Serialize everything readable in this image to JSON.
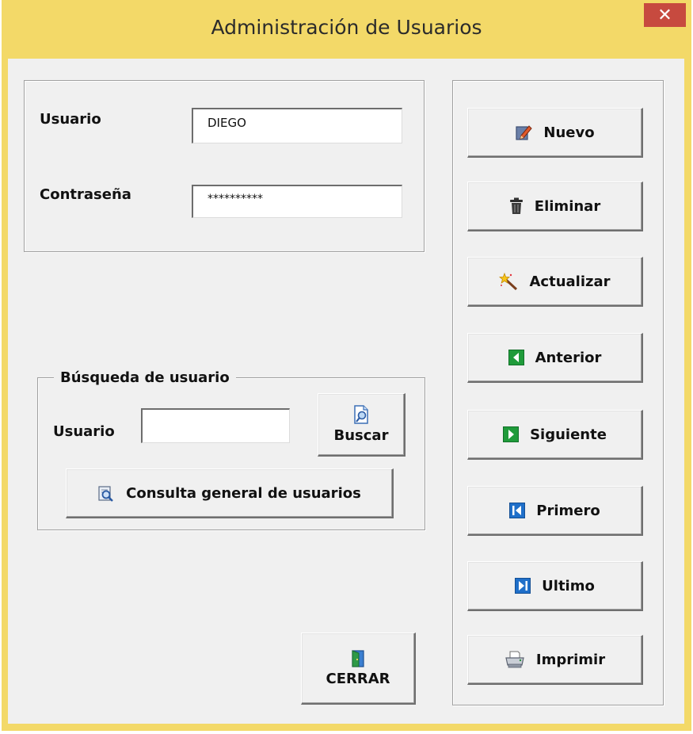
{
  "window": {
    "title": "Administración de Usuarios",
    "close_glyph": "✕"
  },
  "login": {
    "user_label": "Usuario",
    "user_value": "DIEGO",
    "password_label": "Contraseña",
    "password_value": "**********"
  },
  "search": {
    "group_title": "Búsqueda de usuario",
    "user_label": "Usuario",
    "user_value": "",
    "search_button": "Buscar",
    "general_query_button": "Consulta general de usuarios"
  },
  "actions": {
    "new": "Nuevo",
    "delete": "Eliminar",
    "update": "Actualizar",
    "previous": "Anterior",
    "next": "Siguiente",
    "first": "Primero",
    "last": "Ultimo",
    "print": "Imprimir"
  },
  "close_button": "CERRAR",
  "colors": {
    "title_bar": "#f3d968",
    "close": "#c74a3f",
    "nav_green": "#1f9b3a",
    "nav_blue": "#1f6fc9"
  },
  "icons": [
    "edit-icon",
    "trash-icon",
    "magic-wand-icon",
    "arrow-left-icon",
    "arrow-right-icon",
    "first-icon",
    "last-icon",
    "printer-icon",
    "search-doc-icon",
    "query-icon",
    "exit-door-icon"
  ]
}
